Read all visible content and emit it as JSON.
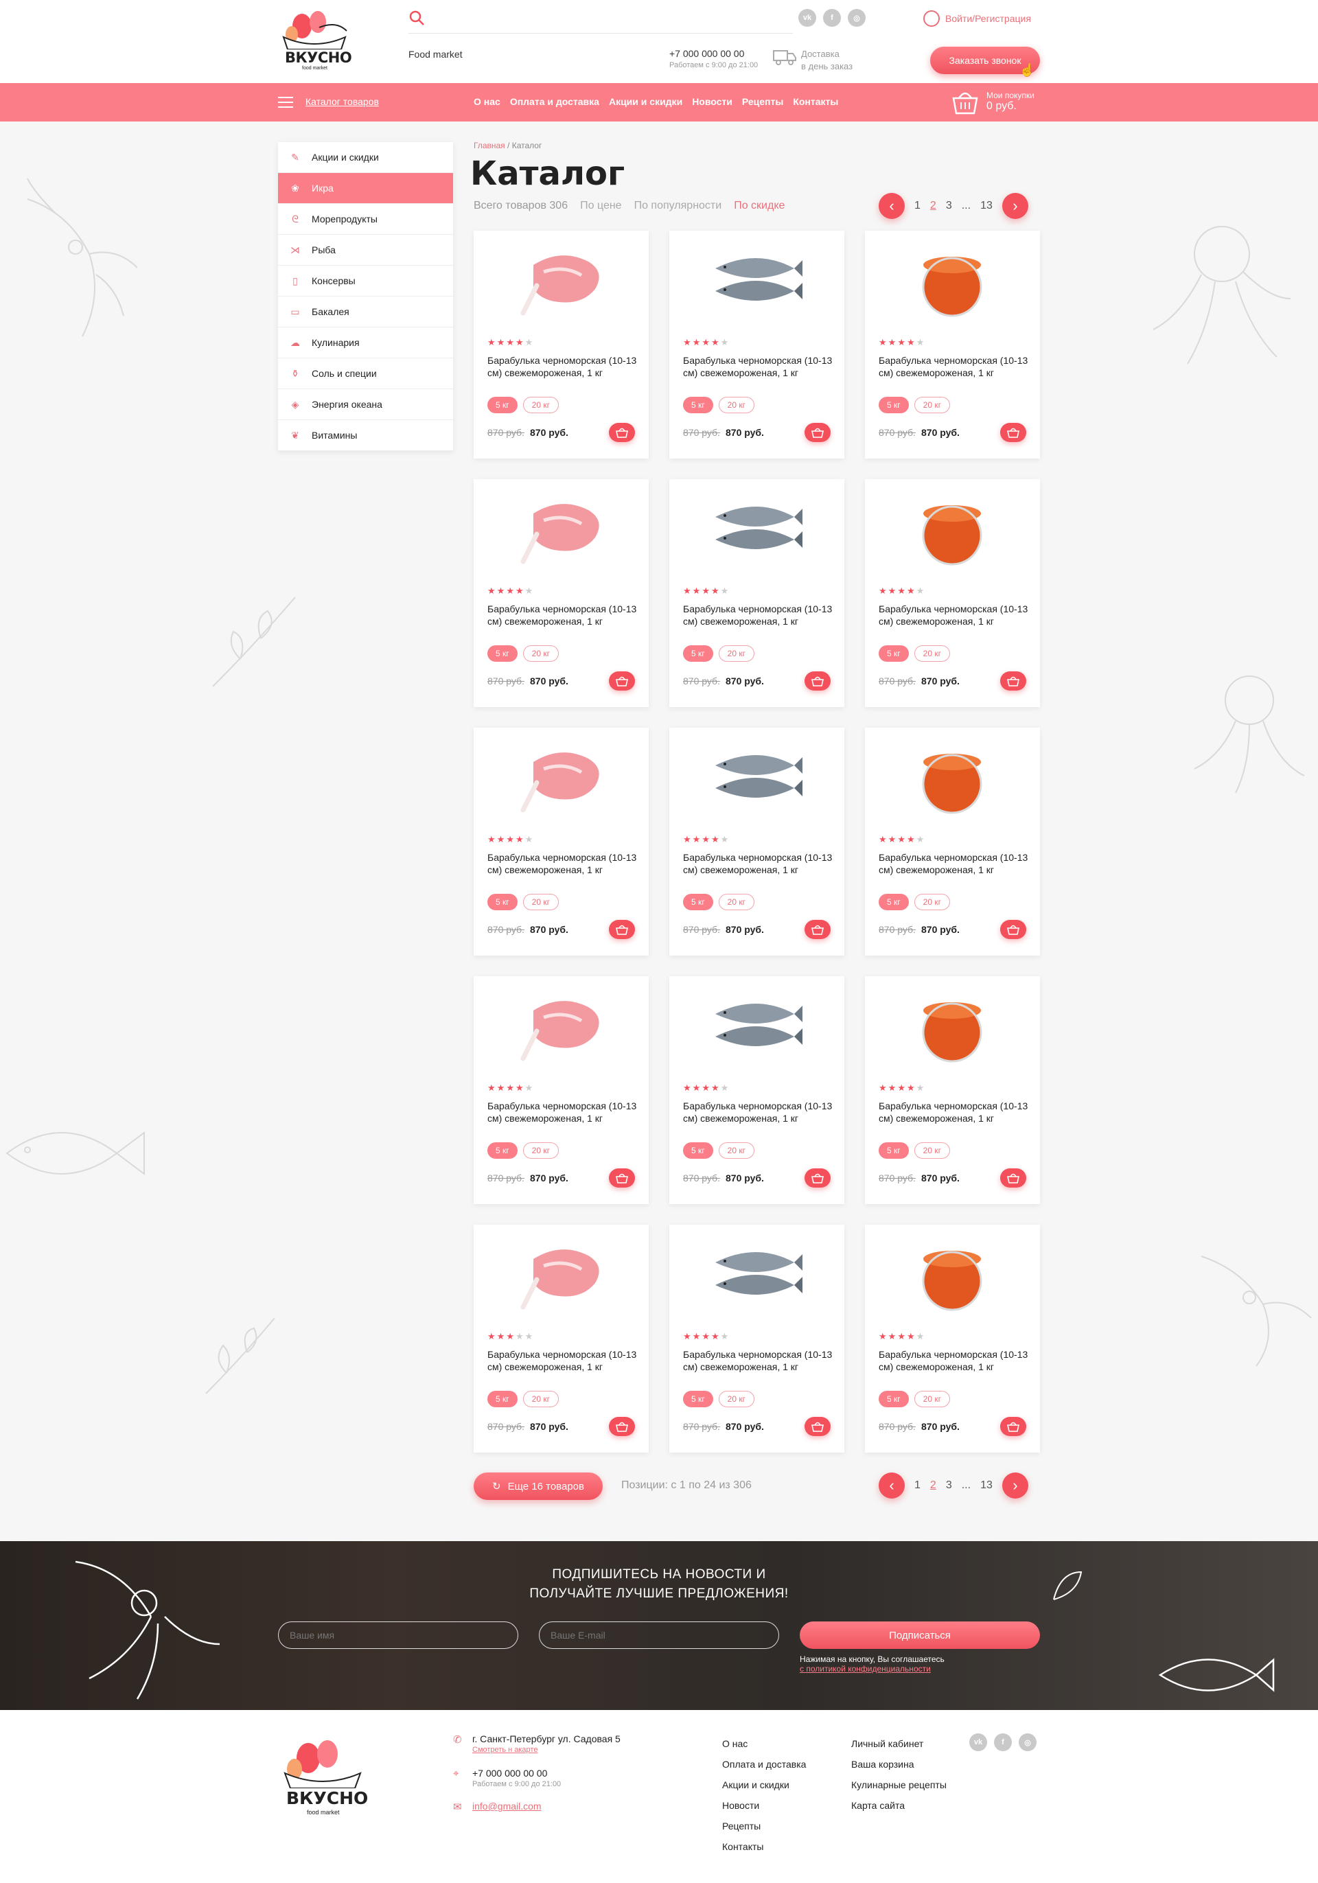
{
  "header": {
    "logo_text": "ВКУСНО",
    "logo_sub": "food market",
    "food_market": "Food market",
    "socials": [
      "vk-icon",
      "facebook-icon",
      "instagram-icon"
    ],
    "login": "Войти/Регистрация",
    "phone": "+7 000 000 00 00",
    "hours": "Работаем с 9:00 до 21:00",
    "delivery_line1": "Доставка",
    "delivery_line2": "в день заказ",
    "callback": "Заказать звонок"
  },
  "nav": {
    "catalog": "Каталог товаров",
    "items": [
      "О нас",
      "Оплата и доставка",
      "Акции и скидки",
      "Новости",
      "Рецепты",
      "Контакты"
    ],
    "cart_label": "Мои покупки",
    "cart_sum": "0 руб."
  },
  "sidebar": {
    "items": [
      {
        "label": "Акции и скидки",
        "icon": "tag-icon",
        "active": false
      },
      {
        "label": "Икра",
        "icon": "caviar-icon",
        "active": true
      },
      {
        "label": "Морепродукты",
        "icon": "shrimp-icon",
        "active": false
      },
      {
        "label": "Рыба",
        "icon": "fish-icon",
        "active": false
      },
      {
        "label": "Консервы",
        "icon": "can-icon",
        "active": false
      },
      {
        "label": "Бакалея",
        "icon": "jar-icon",
        "active": false
      },
      {
        "label": "Кулинария",
        "icon": "chef-hat-icon",
        "active": false
      },
      {
        "label": "Соль и специи",
        "icon": "salt-icon",
        "active": false
      },
      {
        "label": "Энергия океана",
        "icon": "drop-icon",
        "active": false
      },
      {
        "label": "Витамины",
        "icon": "leaf-icon",
        "active": false
      }
    ]
  },
  "breadcrumb": {
    "home": "Главная",
    "sep": " / ",
    "current": "Каталог"
  },
  "title": "Каталог",
  "sort": {
    "total": "Всего товаров 306",
    "by_price": "По цене",
    "by_popularity": "По популярности",
    "by_discount": "По скидке"
  },
  "pagination": {
    "pages": [
      "1",
      "2",
      "3",
      "...",
      "13"
    ],
    "current": "2"
  },
  "product": {
    "name": "Барабулька черноморская (10-13 см) свежемороженая, 1 кг",
    "weight1": "5 кг",
    "weight2": "20 кг",
    "old_price": "870 руб.",
    "price": "870 руб."
  },
  "grid_images": [
    "meat",
    "fish",
    "caviar",
    "meat",
    "fish",
    "caviar",
    "meat",
    "fish",
    "caviar",
    "meat",
    "fish",
    "caviar",
    "meat",
    "fish",
    "caviar"
  ],
  "grid_ratings": [
    4,
    4,
    4,
    4,
    4,
    4,
    4,
    4,
    4,
    4,
    4,
    4,
    3,
    4,
    4
  ],
  "more_button": "Еще 16 товаров",
  "positions": "Позиции: с 1 по 24 из 306",
  "subscribe": {
    "title_line1": "ПОДПИШИТЕСЬ НА НОВОСТИ И",
    "title_line2": "ПОЛУЧАЙТЕ ЛУЧШИЕ ПРЕДЛОЖЕНИЯ!",
    "name_placeholder": "Ваше имя",
    "email_placeholder": "Ваше E-mail",
    "button": "Подписаться",
    "note": "Нажимая на кнопку, Вы соглашаетесь",
    "note_link": "с политикой конфиденциальности"
  },
  "footer": {
    "address": "г. Санкт-Петербург ул. Садовая 5",
    "map_link": "Смотреть н акарте",
    "phone": "+7 000 000 00 00",
    "hours": "Работаем с 9:00 до 21:00",
    "email": "info@gmail.com",
    "col1": [
      "О нас",
      "Оплата и доставка",
      "Акции и скидки",
      "Новости",
      "Рецепты",
      "Контакты"
    ],
    "col2": [
      "Личный кабинет",
      "Ваша корзина",
      "Кулинарные рецепты",
      "Карта сайта"
    ]
  },
  "colors": {
    "accent": "#fa7d88",
    "accent_dark": "#f3505c"
  }
}
